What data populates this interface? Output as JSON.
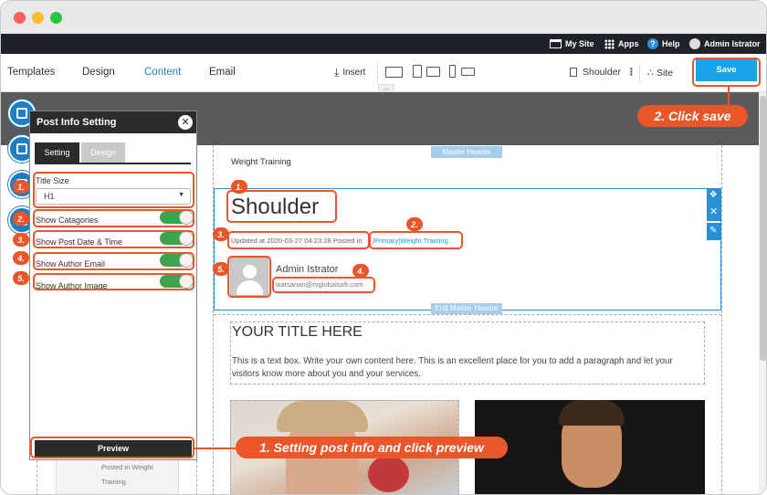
{
  "topbar": {
    "my_site": "My Site",
    "apps": "Apps",
    "help": "Help",
    "user": "Admin Istrator"
  },
  "toolbar": {
    "tabs": [
      "Templates",
      "Design",
      "Content",
      "Email"
    ],
    "insert": "Insert",
    "page_name": "Shoulder",
    "site": "Site",
    "save": "Save"
  },
  "panel": {
    "title": "Post Info Setting",
    "tabs": [
      "Setting",
      "Design"
    ],
    "title_size_label": "Title Size",
    "title_size_value": "H1",
    "options": [
      {
        "label": "Show Catagories",
        "on": true
      },
      {
        "label": "Show Post Date & Time",
        "on": true
      },
      {
        "label": "Show Author Email",
        "on": true
      },
      {
        "label": "Show Author Image",
        "on": true
      }
    ],
    "preview": "Preview",
    "behind_text_1": "Posted in Weight",
    "behind_text_2": "Training"
  },
  "page": {
    "category_heading": "Weight Training",
    "master_header": "Master Header",
    "end_master_header": "End Master Header",
    "post_title": "Shoulder",
    "meta_prefix": "Updated at 2020-03-27 04:23:28 Posted in",
    "meta_link": "|Primary|Weight Training.",
    "author_name": "Admin Istrator",
    "author_email": "watsanan@rvglobalsoft.com",
    "text_title": "YOUR TITLE HERE",
    "text_body": "This is a text box. Write your own content here. This is an excellent place for you to add a paragraph and let your visitors know more about you and your services."
  },
  "annotations": {
    "badges": [
      "1.",
      "2.",
      "3.",
      "4.",
      "5."
    ],
    "click_save": "2. Click save",
    "setting_preview": "1. Setting post info and click preview"
  },
  "colors": {
    "accent": "#e8562a",
    "save_blue": "#1aa3e8",
    "toggle_green": "#3aa54c",
    "link_blue": "#2b8fd6"
  }
}
